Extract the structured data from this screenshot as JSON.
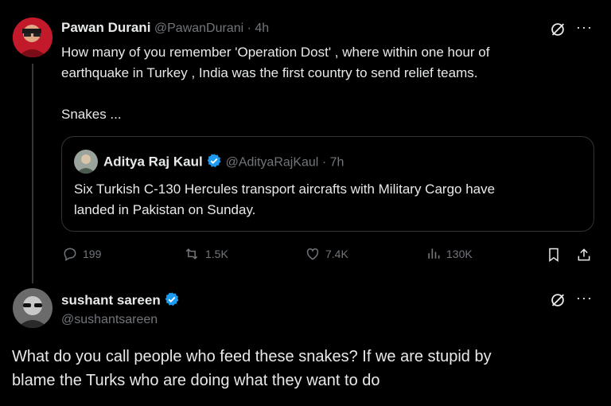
{
  "post1": {
    "display_name": "Pawan Durani",
    "handle": "@PawanDurani",
    "separator": "·",
    "time": "4h",
    "text_line1": "How many of you remember 'Operation Dost' , where within one hour of",
    "text_line2": "earthquake in Turkey , India was the first country to send relief teams.",
    "text_line3": "Snakes ...",
    "more_label": "···"
  },
  "quote": {
    "display_name": "Aditya Raj Kaul",
    "handle": "@AdityaRajKaul",
    "separator": "·",
    "time": "7h",
    "text_line1": "Six Turkish C-130 Hercules transport aircrafts with Military Cargo have",
    "text_line2": "landed in Pakistan on Sunday."
  },
  "actions": {
    "replies": "199",
    "reposts": "1.5K",
    "likes": "7.4K",
    "views": "130K"
  },
  "post2": {
    "display_name": "sushant sareen",
    "handle": "@sushantsareen",
    "text_line1": "What do you call people who feed these snakes? If we are stupid by",
    "text_line2": "blame the Turks who are doing what they want to do",
    "more_label": "···"
  },
  "colors": {
    "background": "#000000",
    "text": "#e7e9ea",
    "muted": "#71767b",
    "verified": "#1d9bf0",
    "border": "#2f3336"
  }
}
